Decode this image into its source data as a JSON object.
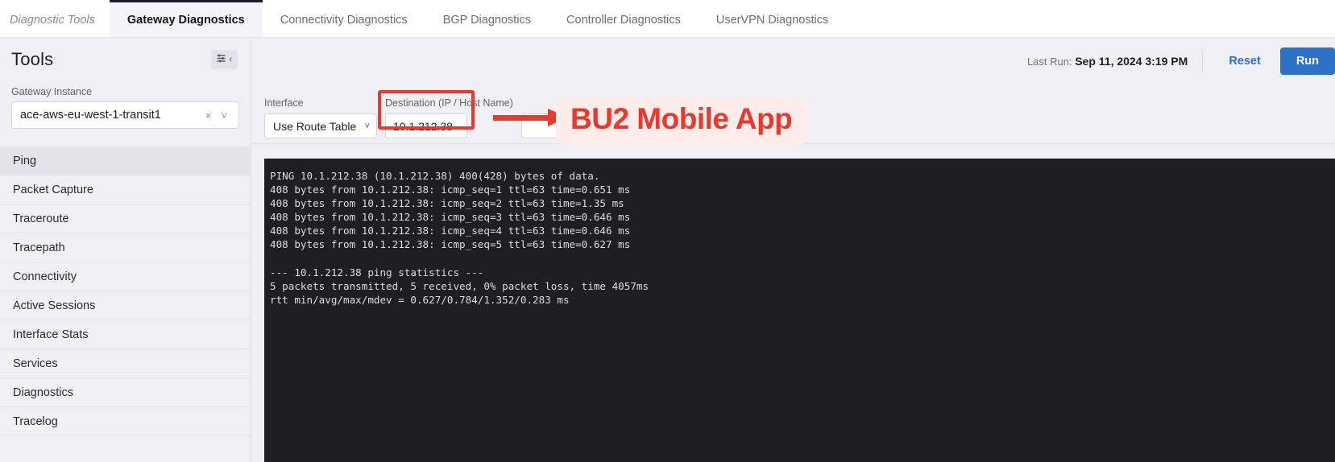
{
  "tabs": [
    {
      "label": "Diagnostic Tools",
      "style": "breadcrumb",
      "active": false
    },
    {
      "label": "Gateway Diagnostics",
      "style": "tab",
      "active": true
    },
    {
      "label": "Connectivity Diagnostics",
      "style": "tab",
      "active": false
    },
    {
      "label": "BGP Diagnostics",
      "style": "tab",
      "active": false
    },
    {
      "label": "Controller Diagnostics",
      "style": "tab",
      "active": false
    },
    {
      "label": "UserVPN Diagnostics",
      "style": "tab",
      "active": false
    }
  ],
  "sidebar": {
    "title": "Tools",
    "panel_toggle": {
      "settings_glyph": "☰",
      "chevron_glyph": "‹"
    },
    "gateway_instance": {
      "label": "Gateway Instance",
      "value": "ace-aws-eu-west-1-transit1",
      "clear_glyph": "×",
      "chevron_glyph": "˅"
    },
    "items": [
      {
        "label": "Ping",
        "selected": true
      },
      {
        "label": "Packet Capture",
        "selected": false
      },
      {
        "label": "Traceroute",
        "selected": false
      },
      {
        "label": "Tracepath",
        "selected": false
      },
      {
        "label": "Connectivity",
        "selected": false
      },
      {
        "label": "Active Sessions",
        "selected": false
      },
      {
        "label": "Interface Stats",
        "selected": false
      },
      {
        "label": "Services",
        "selected": false
      },
      {
        "label": "Diagnostics",
        "selected": false
      },
      {
        "label": "Tracelog",
        "selected": false
      }
    ]
  },
  "toolbar": {
    "last_run_label": "Last Run:",
    "last_run_value": "Sep 11, 2024 3:19 PM",
    "reset_label": "Reset",
    "run_label": "Run"
  },
  "form": {
    "interface": {
      "label": "Interface",
      "value": "Use Route Table",
      "chevron_glyph": "˅"
    },
    "destination": {
      "label": "Destination (IP / Host Name)",
      "value": "10.1.212.38",
      "placeholder": ""
    }
  },
  "annotation": {
    "text": "BU2 Mobile App",
    "color": "#e8392e",
    "background": "#fdecea"
  },
  "terminal": {
    "background": "#1e1e24",
    "text_color": "#dcdce2",
    "output": "PING 10.1.212.38 (10.1.212.38) 400(428) bytes of data.\n408 bytes from 10.1.212.38: icmp_seq=1 ttl=63 time=0.651 ms\n408 bytes from 10.1.212.38: icmp_seq=2 ttl=63 time=1.35 ms\n408 bytes from 10.1.212.38: icmp_seq=3 ttl=63 time=0.646 ms\n408 bytes from 10.1.212.38: icmp_seq=4 ttl=63 time=0.646 ms\n408 bytes from 10.1.212.38: icmp_seq=5 ttl=63 time=0.627 ms\n\n--- 10.1.212.38 ping statistics ---\n5 packets transmitted, 5 received, 0% packet loss, time 4057ms\nrtt min/avg/max/mdev = 0.627/0.784/1.352/0.283 ms"
  },
  "colors": {
    "accent_blue": "#2c72c9",
    "link_blue": "#2a6fd6",
    "page_bg": "#f0f0f4",
    "active_tab_border": "#1d1d2b"
  }
}
